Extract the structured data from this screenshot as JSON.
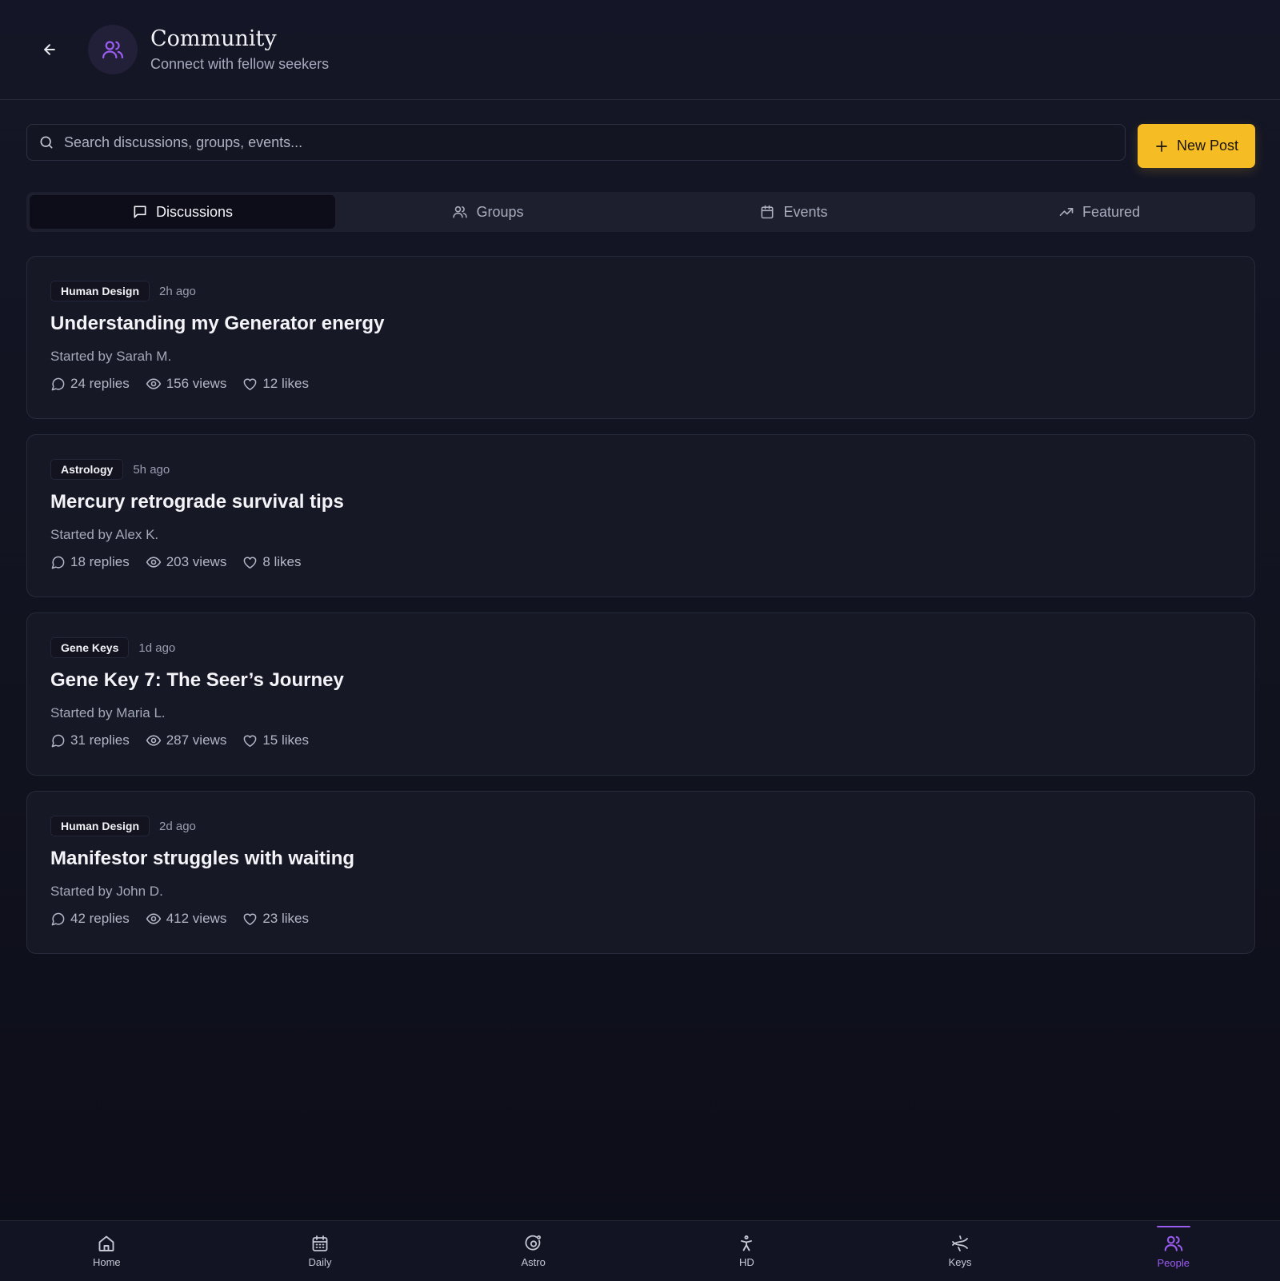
{
  "header": {
    "title": "Community",
    "subtitle": "Connect with fellow seekers",
    "avatar_icon": "users-icon",
    "accent": "#9b5cf0"
  },
  "search": {
    "placeholder": "Search discussions, groups, events...",
    "value": ""
  },
  "new_post": {
    "label": "New Post",
    "color": "#f6bc23"
  },
  "tabs": [
    {
      "label": "Discussions",
      "icon": "message-square-icon",
      "active": true
    },
    {
      "label": "Groups",
      "icon": "users-icon",
      "active": false
    },
    {
      "label": "Events",
      "icon": "calendar-icon",
      "active": false
    },
    {
      "label": "Featured",
      "icon": "trending-up-icon",
      "active": false
    }
  ],
  "discussions": [
    {
      "tag": "Human Design",
      "time": "2h ago",
      "title": "Understanding my Generator energy",
      "author": "Started by Sarah M.",
      "replies": "24 replies",
      "views": "156 views",
      "likes": "12 likes"
    },
    {
      "tag": "Astrology",
      "time": "5h ago",
      "title": "Mercury retrograde survival tips",
      "author": "Started by Alex K.",
      "replies": "18 replies",
      "views": "203 views",
      "likes": "8 likes"
    },
    {
      "tag": "Gene Keys",
      "time": "1d ago",
      "title": "Gene Key 7: The Seer’s Journey",
      "author": "Started by Maria L.",
      "replies": "31 replies",
      "views": "287 views",
      "likes": "15 likes"
    },
    {
      "tag": "Human Design",
      "time": "2d ago",
      "title": "Manifestor struggles with waiting",
      "author": "Started by John D.",
      "replies": "42 replies",
      "views": "412 views",
      "likes": "23 likes"
    }
  ],
  "nav": [
    {
      "label": "Home",
      "icon": "home-icon",
      "active": false
    },
    {
      "label": "Daily",
      "icon": "calendar-grid-icon",
      "active": false
    },
    {
      "label": "Astro",
      "icon": "astro-icon",
      "active": false
    },
    {
      "label": "HD",
      "icon": "person-icon",
      "active": false
    },
    {
      "label": "Keys",
      "icon": "dna-icon",
      "active": false
    },
    {
      "label": "People",
      "icon": "users-icon",
      "active": true
    }
  ]
}
